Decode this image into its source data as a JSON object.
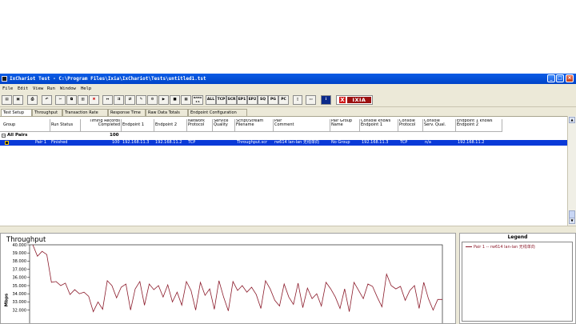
{
  "window": {
    "title": "IxChariot Test - C:\\Program Files\\Ixia\\IxChariot\\Tests\\untitled1.tst",
    "controls": [
      "_",
      "□",
      "×"
    ]
  },
  "menu": [
    "File",
    "Edit",
    "View",
    "Run",
    "Window",
    "Help"
  ],
  "toolbar": {
    "protocol_buttons": [
      "ALL",
      "TCP",
      "SCR",
      "EP1",
      "EP2",
      "SQ",
      "PG",
      "PC"
    ],
    "ratio_button": "RATIO 1:1",
    "ratio_button_2": "RATIO 1:2",
    "brand": {
      "x": "X",
      "text": "IXIA"
    }
  },
  "tabs": [
    "Test Setup",
    "Throughput",
    "Transaction Rate",
    "Response Time",
    "Raw Data Totals",
    "Endpoint Configuration"
  ],
  "table": {
    "headers": [
      "Group",
      "Run Status",
      "Timing Records\nCompleted",
      "Endpoint 1",
      "Endpoint 2",
      "Network\nProtocol",
      "Service\nQuality",
      "Script/Stream\nFilename",
      "Pair\nComment",
      "Pair Group\nName",
      "Console knows\nEndpoint 1",
      "Console\nProtocol",
      "Console\nServ. Qual.",
      "Endpoint 1 knows\nEndpoint 2"
    ],
    "all_pairs_label": "All Pairs",
    "all_pairs_count": "100",
    "row": {
      "group": "Pair 1",
      "status": "Finished",
      "records": "100",
      "endpoint1": "192.168.11.3",
      "endpoint2": "192.168.11.2",
      "protocol": "TCP",
      "script": "Throughput.scr",
      "comment": "rw614 lan-lan 无线单向",
      "pair_group": "No Group",
      "console_knows": "192.168.11.3",
      "console_protocol": "TCP",
      "console_qual": "n/a",
      "ep1_knows": "192.168.11.2"
    }
  },
  "chart": {
    "title": "Throughput",
    "ylabel": "Mbps",
    "legend_title": "Legend",
    "legend_entry": "Pair 1 -- rw614 lan-lan 无线单向",
    "color": "#8b1a2a"
  },
  "chart_data": {
    "type": "line",
    "title": "Throughput",
    "xlabel": "",
    "ylabel": "Mbps",
    "yticks": [
      "40.000",
      "39.000",
      "38.000",
      "37.000",
      "36.000",
      "35.000",
      "34.000",
      "33.000",
      "32.000"
    ],
    "ylim": [
      32,
      40
    ],
    "series": [
      {
        "name": "Pair 1 -- rw614 lan-lan 无线单向",
        "values": [
          40.0,
          38.6,
          39.2,
          38.8,
          35.4,
          35.5,
          35.0,
          35.3,
          33.9,
          34.5,
          34.0,
          34.2,
          33.7,
          31.8,
          33.0,
          32.1,
          35.6,
          35.0,
          33.5,
          34.8,
          35.2,
          32.0,
          34.6,
          35.5,
          32.6,
          35.2,
          34.5,
          35.0,
          33.6,
          35.1,
          33.0,
          34.2,
          32.6,
          35.5,
          34.4,
          32.0,
          35.4,
          33.8,
          34.6,
          32.1,
          35.6,
          33.6,
          31.9,
          35.5,
          34.4,
          35.0,
          34.2,
          34.8,
          33.9,
          32.2,
          35.6,
          34.6,
          33.2,
          32.5,
          35.2,
          33.6,
          32.7,
          35.3,
          32.3,
          34.7,
          33.4,
          34.0,
          32.5,
          35.4,
          34.6,
          33.6,
          32.2,
          34.6,
          31.8,
          35.4,
          34.4,
          33.4,
          35.2,
          34.9,
          33.6,
          32.4,
          36.4,
          35.0,
          34.6,
          34.9,
          33.2,
          34.4,
          35.0,
          32.2,
          35.4,
          33.4,
          32.0,
          33.3,
          33.3
        ]
      }
    ]
  }
}
